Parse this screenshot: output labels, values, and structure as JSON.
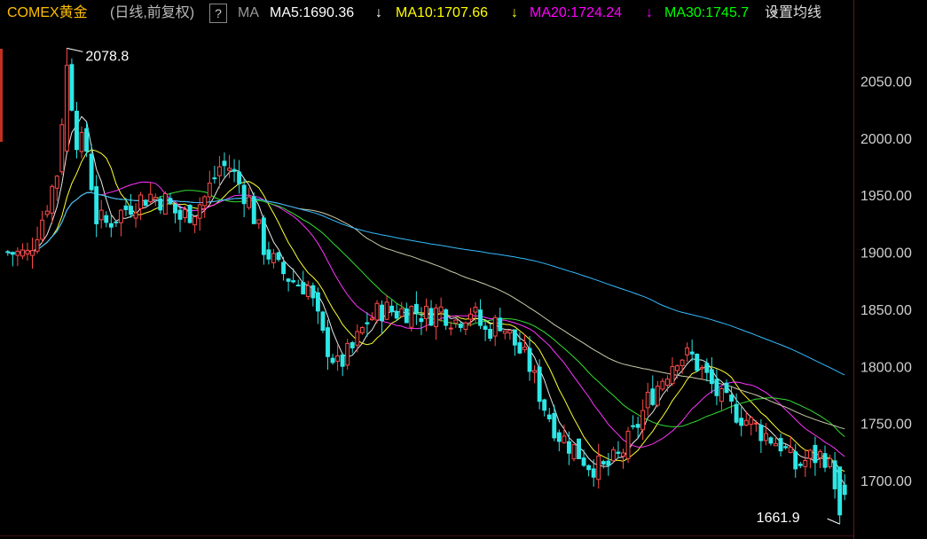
{
  "header": {
    "symbol": "COMEX黄金",
    "mode": "(日线,前复权)",
    "help_label": "?",
    "ma_label": "MA",
    "settings_label": "设置均线",
    "ma_items": [
      {
        "label": "MA5:1690.36",
        "arrow": "↓",
        "color": "#ffffff"
      },
      {
        "label": "MA10:1707.66",
        "arrow": "↓",
        "color": "#ffff00"
      },
      {
        "label": "MA20:1724.24",
        "arrow": "↓",
        "color": "#ff00ff"
      },
      {
        "label": "MA30:1745.7",
        "arrow": "",
        "color": "#00ff00"
      }
    ],
    "dropdown_icon": "caret-down-icon"
  },
  "chart_data": {
    "type": "candlestick",
    "ylim": [
      1655,
      2090
    ],
    "yticks": [
      1700,
      1750,
      1800,
      1850,
      1900,
      1950,
      2000,
      2050
    ],
    "ytick_labels": [
      "1700.00",
      "1750.00",
      "1800.00",
      "1850.00",
      "1900.00",
      "1950.00",
      "2000.00",
      "2050.00"
    ],
    "grid": false,
    "annotations": [
      {
        "label": "2078.8",
        "bar_index": 12,
        "value": 2078.8,
        "type": "high"
      },
      {
        "label": "1661.9",
        "bar_index": 169,
        "value": 1661.9,
        "type": "low"
      }
    ],
    "up_color": "#ff4a4a",
    "down_color": "#2ee6e6",
    "ma_colors": {
      "ma5": "#e8e8e8",
      "ma10": "#ffff33",
      "ma20": "#ff33ff",
      "ma30": "#33dd33",
      "ma60": "#ccccaa",
      "ma120": "#33bbff"
    },
    "close_anchors": [
      [
        0,
        1900
      ],
      [
        4,
        1898
      ],
      [
        7,
        1930
      ],
      [
        10,
        1970
      ],
      [
        12,
        2065
      ],
      [
        14,
        2000
      ],
      [
        16,
        1990
      ],
      [
        18,
        1930
      ],
      [
        20,
        1925
      ],
      [
        23,
        1935
      ],
      [
        26,
        1945
      ],
      [
        29,
        1950
      ],
      [
        32,
        1945
      ],
      [
        35,
        1930
      ],
      [
        38,
        1938
      ],
      [
        40,
        1948
      ],
      [
        43,
        1975
      ],
      [
        45,
        1975
      ],
      [
        47,
        1960
      ],
      [
        49,
        1945
      ],
      [
        52,
        1905
      ],
      [
        55,
        1885
      ],
      [
        58,
        1875
      ],
      [
        61,
        1870
      ],
      [
        64,
        1825
      ],
      [
        67,
        1800
      ],
      [
        70,
        1815
      ],
      [
        73,
        1840
      ],
      [
        76,
        1850
      ],
      [
        79,
        1848
      ],
      [
        82,
        1850
      ],
      [
        85,
        1845
      ],
      [
        88,
        1850
      ],
      [
        91,
        1840
      ],
      [
        94,
        1850
      ],
      [
        97,
        1830
      ],
      [
        100,
        1840
      ],
      [
        103,
        1820
      ],
      [
        106,
        1800
      ],
      [
        109,
        1765
      ],
      [
        112,
        1740
      ],
      [
        115,
        1728
      ],
      [
        118,
        1715
      ],
      [
        121,
        1710
      ],
      [
        124,
        1720
      ],
      [
        127,
        1740
      ],
      [
        130,
        1770
      ],
      [
        133,
        1790
      ],
      [
        136,
        1810
      ],
      [
        139,
        1808
      ],
      [
        142,
        1790
      ],
      [
        145,
        1770
      ],
      [
        148,
        1760
      ],
      [
        151,
        1750
      ],
      [
        154,
        1740
      ],
      [
        157,
        1732
      ],
      [
        160,
        1712
      ],
      [
        163,
        1720
      ],
      [
        166,
        1722
      ],
      [
        169,
        1690
      ],
      [
        170,
        1680
      ]
    ]
  }
}
